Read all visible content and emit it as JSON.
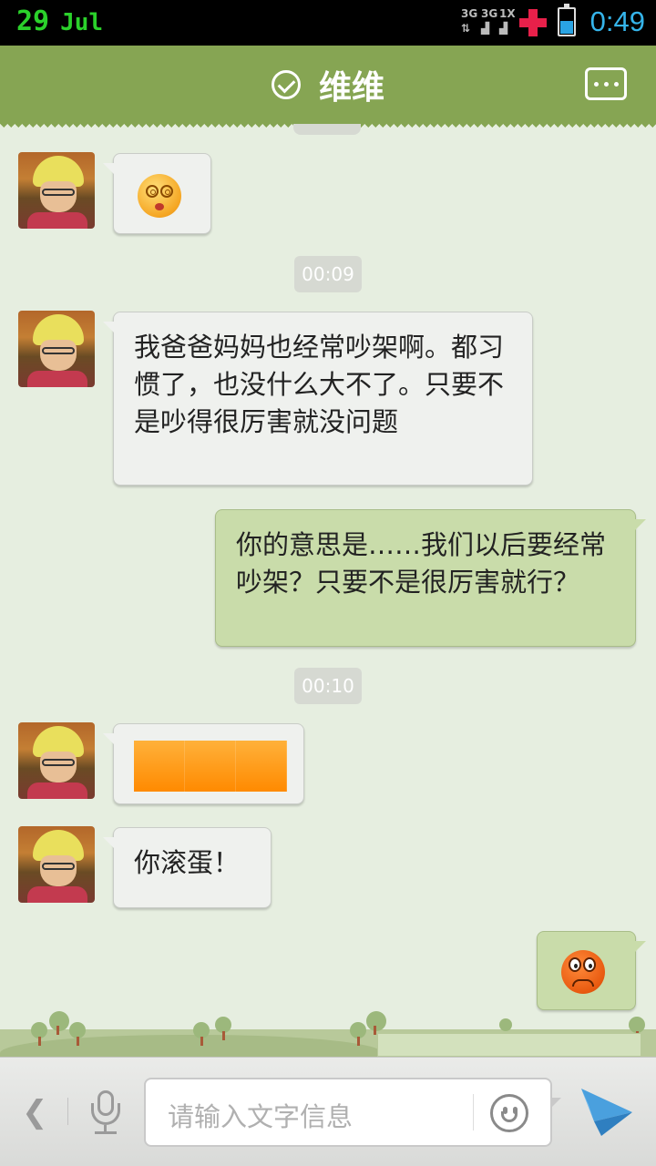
{
  "status_bar": {
    "date_day": "29",
    "date_month": "Jul",
    "net_labels": [
      "3G",
      "3G",
      "1X"
    ],
    "time": "0:49",
    "battery_level": 0.5
  },
  "header": {
    "title": "维维",
    "verified_icon": "check-circle-icon",
    "more_icon": "more-dots-icon"
  },
  "messages": [
    {
      "side": "in",
      "type": "emoji",
      "emoji": "dizzy-face-icon"
    },
    {
      "type": "timestamp",
      "text": "00:09"
    },
    {
      "side": "in",
      "type": "text",
      "text": "我爸爸妈妈也经常吵架啊。都习惯了，也没什么大不了。只要不是吵得很厉害就没问题"
    },
    {
      "side": "out",
      "type": "text",
      "text": "你的意思是……我们以后要经常吵架？只要不是很厉害就行？"
    },
    {
      "type": "timestamp",
      "text": "00:10"
    },
    {
      "side": "in",
      "type": "image",
      "image": "orange-block"
    },
    {
      "side": "in",
      "type": "text",
      "text": "你滚蛋！"
    },
    {
      "side": "out",
      "type": "emoji",
      "emoji": "angry-face-icon"
    }
  ],
  "input_bar": {
    "back_icon": "chevron-left-icon",
    "back_glyph": "❮",
    "mic_icon": "microphone-icon",
    "placeholder": "请输入文字信息",
    "emoji_icon": "smiley-icon",
    "send_icon": "send-paper-plane-icon"
  },
  "colors": {
    "header": "#86a553",
    "chat_bg": "#e6eee0",
    "bubble_in": "#eff1ee",
    "bubble_out": "#c9dcaa",
    "time_accent": "#35b4ea",
    "date_green": "#2bd12b"
  }
}
